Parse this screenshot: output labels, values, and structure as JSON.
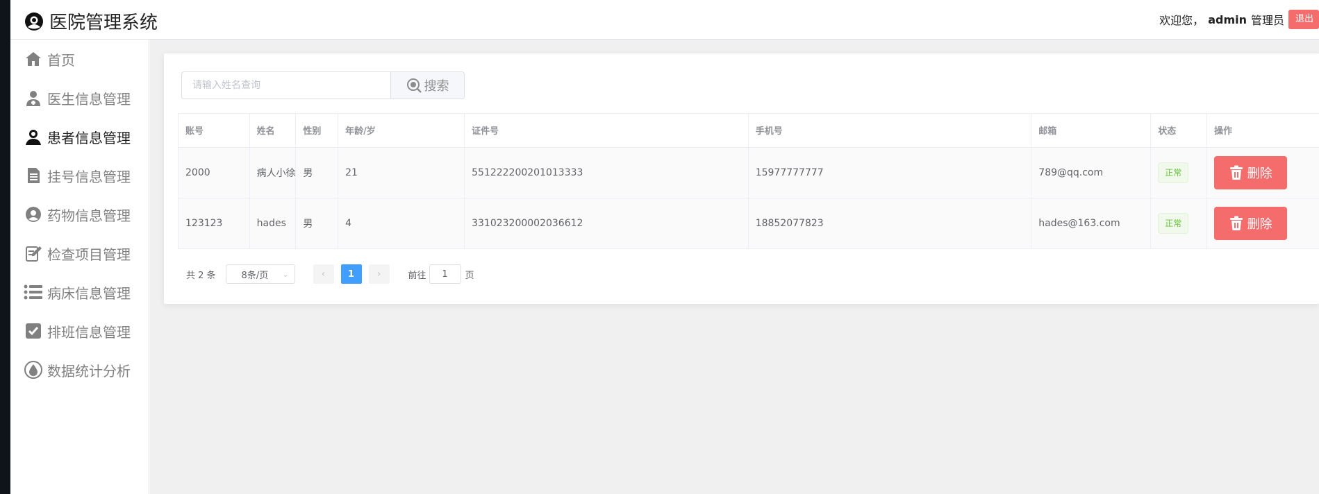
{
  "header": {
    "app_title": "医院管理系统",
    "welcome": "欢迎您，",
    "username": "admin",
    "role": "管理员",
    "logout_label": "退出"
  },
  "sidebar": {
    "items": [
      {
        "label": "首页",
        "icon": "home-icon"
      },
      {
        "label": "医生信息管理",
        "icon": "doctor-icon"
      },
      {
        "label": "患者信息管理",
        "icon": "patient-icon",
        "active": true
      },
      {
        "label": "挂号信息管理",
        "icon": "register-doc-icon"
      },
      {
        "label": "药物信息管理",
        "icon": "medicine-icon"
      },
      {
        "label": "检查项目管理",
        "icon": "edit-check-icon"
      },
      {
        "label": "病床信息管理",
        "icon": "list-icon"
      },
      {
        "label": "排班信息管理",
        "icon": "checkbox-icon"
      },
      {
        "label": "数据统计分析",
        "icon": "drop-icon"
      }
    ]
  },
  "search": {
    "placeholder": "请输入姓名查询",
    "value": "",
    "button_label": "搜索"
  },
  "table": {
    "columns": [
      "账号",
      "姓名",
      "性别",
      "年龄/岁",
      "证件号",
      "手机号",
      "邮箱",
      "状态",
      "操作"
    ],
    "rows": [
      {
        "account": "2000",
        "name": "病人小徐",
        "gender": "男",
        "age": "21",
        "id_card": "551222200201013333",
        "phone": "15977777777",
        "email": "789@qq.com",
        "status": "正常",
        "action": "删除"
      },
      {
        "account": "123123",
        "name": "hades",
        "gender": "男",
        "age": "4",
        "id_card": "331023200002036612",
        "phone": "18852077823",
        "email": "hades@163.com",
        "status": "正常",
        "action": "删除"
      }
    ]
  },
  "pagination": {
    "total": "共 2 条",
    "page_size": "8条/页",
    "current_page": "1",
    "goto_prefix": "前往",
    "goto_value": "1",
    "goto_suffix": "页"
  },
  "colors": {
    "danger": "#f56c6c",
    "primary": "#409eff",
    "success": "#67c23a"
  }
}
